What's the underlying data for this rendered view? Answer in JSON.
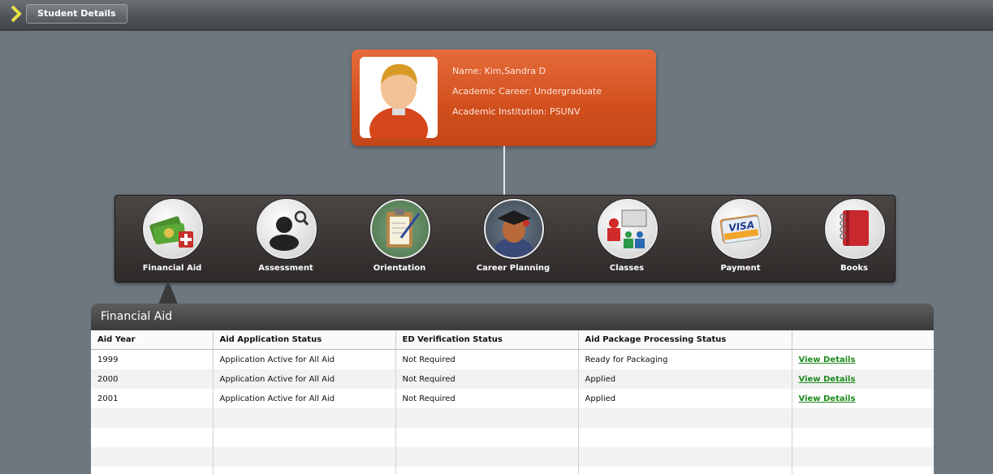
{
  "header": {
    "breadcrumb_label": "Student Details",
    "breadcrumb_icon": "chevron-right-icon",
    "accent": "#e8e14a"
  },
  "student": {
    "name_line": "Name: Kim,Sandra D",
    "career_line": "Academic Career: Undergraduate",
    "institution_line": "Academic Institution: PSUNV",
    "card_color": "#d55221"
  },
  "nav": {
    "items": [
      {
        "label": "Financial Aid",
        "icon": "money-icon"
      },
      {
        "label": "Assessment",
        "icon": "assessment-icon"
      },
      {
        "label": "Orientation",
        "icon": "clipboard-icon"
      },
      {
        "label": "Career Planning",
        "icon": "graduate-icon"
      },
      {
        "label": "Classes",
        "icon": "classroom-icon"
      },
      {
        "label": "Payment",
        "icon": "credit-card-icon"
      },
      {
        "label": "Books",
        "icon": "notebook-icon"
      }
    ],
    "selected": "Financial Aid"
  },
  "panel": {
    "title": "Financial Aid",
    "columns": [
      "Aid Year",
      "Aid Application Status",
      "ED Verification Status",
      "Aid Package Processing Status",
      ""
    ],
    "rows": [
      {
        "year": "1999",
        "app_status": "Application Active for All Aid",
        "ed_status": "Not Required",
        "package_status": "Ready for Packaging",
        "link": "View Details"
      },
      {
        "year": "2000",
        "app_status": "Application Active for All Aid",
        "ed_status": "Not Required",
        "package_status": "Applied",
        "link": "View Details"
      },
      {
        "year": "2001",
        "app_status": "Application Active for All Aid",
        "ed_status": "Not Required",
        "package_status": "Applied",
        "link": "View Details"
      }
    ],
    "link_color": "#1d8a1d"
  }
}
